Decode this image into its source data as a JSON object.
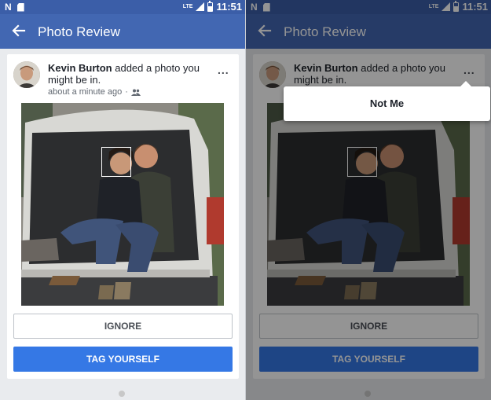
{
  "status_bar": {
    "time": "11:51",
    "network": "LTE",
    "n_logo": "N"
  },
  "app_bar": {
    "title": "Photo Review",
    "back_icon": "arrow-left-icon"
  },
  "post": {
    "author": "Kevin Burton",
    "action": " added a photo you might be in.",
    "time": "about a minute ago",
    "separator": "·",
    "more": "..."
  },
  "buttons": {
    "ignore": "IGNORE",
    "tag": "TAG YOURSELF"
  },
  "popup_menu": {
    "items": [
      "Not Me"
    ]
  },
  "colors": {
    "status_bar": "#3b5ea8",
    "app_bar": "#4267b2",
    "primary_button": "#3578e5",
    "background": "#e9ebee"
  }
}
